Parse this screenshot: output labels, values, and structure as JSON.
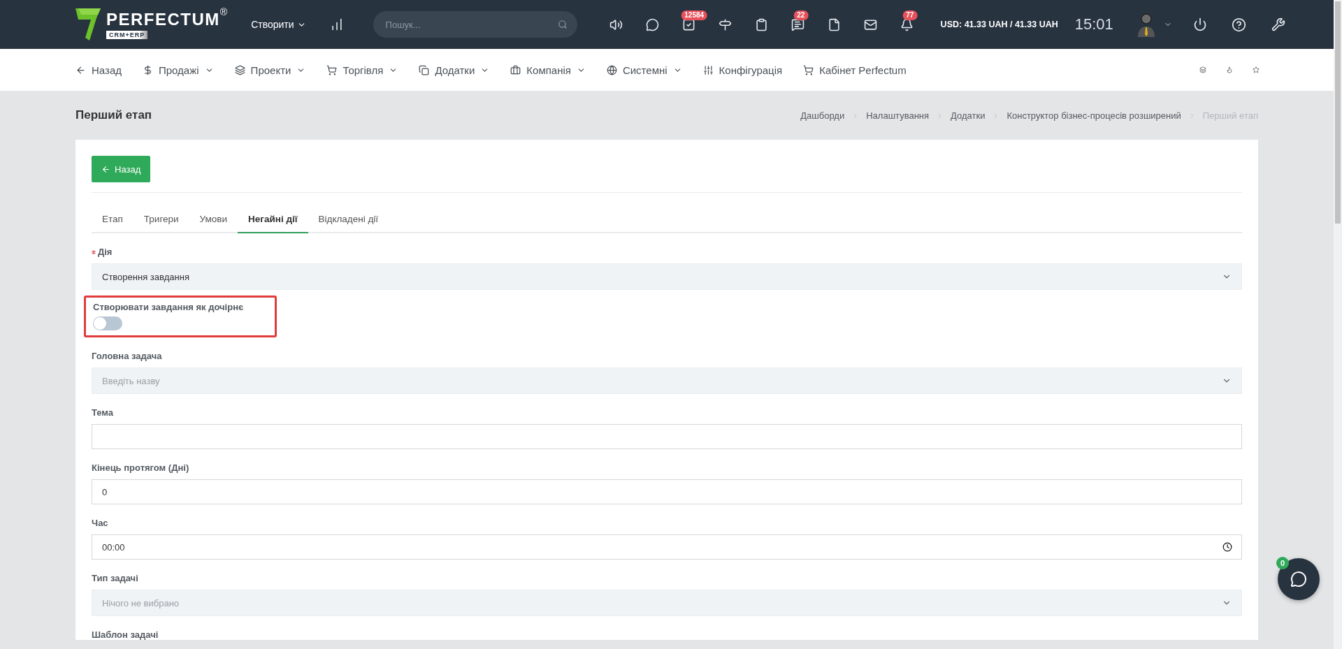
{
  "topbar": {
    "logo": {
      "name": "PERFECTUM",
      "registered": "®",
      "tagline": "CRM+ERP"
    },
    "create_menu": "Створити",
    "search": {
      "placeholder": "Пошук..."
    },
    "icons": [
      {
        "kind": "speaker"
      },
      {
        "kind": "chat"
      },
      {
        "kind": "tasks",
        "badge": "12584"
      },
      {
        "kind": "signpost"
      },
      {
        "kind": "clipboard"
      },
      {
        "kind": "messages",
        "badge": "22"
      },
      {
        "kind": "file"
      },
      {
        "kind": "mail"
      },
      {
        "kind": "bell",
        "badge": "77"
      }
    ],
    "currency": "USD: 41.33 UAH / 41.33 UAH",
    "clock": "15:01"
  },
  "nav": {
    "items": [
      {
        "kind": "back",
        "label": "Назад",
        "dropdown": false
      },
      {
        "kind": "dollar",
        "label": "Продажі",
        "dropdown": true
      },
      {
        "kind": "layers",
        "label": "Проекти",
        "dropdown": true
      },
      {
        "kind": "cart",
        "label": "Торгівля",
        "dropdown": true
      },
      {
        "kind": "copy",
        "label": "Додатки",
        "dropdown": true
      },
      {
        "kind": "briefcase",
        "label": "Компанія",
        "dropdown": true
      },
      {
        "kind": "globe",
        "label": "Системні",
        "dropdown": true
      },
      {
        "kind": "sliders",
        "label": "Конфігурація",
        "dropdown": false
      },
      {
        "kind": "cart",
        "label": "Кабінет Perfectum",
        "dropdown": false
      }
    ],
    "tools": [
      {
        "kind": "layers"
      },
      {
        "kind": "flame"
      },
      {
        "kind": "star"
      }
    ]
  },
  "page": {
    "title": "Перший етап",
    "breadcrumbs": [
      {
        "label": "Дашборди",
        "current": false
      },
      {
        "label": "Налаштування",
        "current": false
      },
      {
        "label": "Додатки",
        "current": false
      },
      {
        "label": "Конструктор бізнес-процесів розширений",
        "current": false
      },
      {
        "label": "Перший етап",
        "current": true
      }
    ]
  },
  "card": {
    "back_button": "Назад",
    "tabs": [
      {
        "label": "Етап",
        "selected": false
      },
      {
        "label": "Тригери",
        "selected": false
      },
      {
        "label": "Умови",
        "selected": false
      },
      {
        "label": "Негайні дії",
        "selected": true
      },
      {
        "label": "Відкладені дії",
        "selected": false
      }
    ],
    "fields": [
      {
        "kind": "select",
        "label": "Дія",
        "required": true,
        "value": "Створення завдання"
      },
      {
        "kind": "toggle",
        "label": "Створювати завдання як дочірнє",
        "on": false,
        "highlighted": true
      },
      {
        "kind": "select",
        "label": "Головна задача",
        "placeholder": "Введіть назву"
      },
      {
        "kind": "text",
        "label": "Тема"
      },
      {
        "kind": "text",
        "label": "Кінець протягом (Дні)",
        "value": "0"
      },
      {
        "kind": "time",
        "label": "Час",
        "value": "00:00"
      },
      {
        "kind": "select",
        "label": "Тип задачі",
        "placeholder": "Нічого не вибрано"
      },
      {
        "kind": "label",
        "label": "Шаблон задачі"
      }
    ]
  },
  "chat_widget": {
    "badge": "0"
  }
}
